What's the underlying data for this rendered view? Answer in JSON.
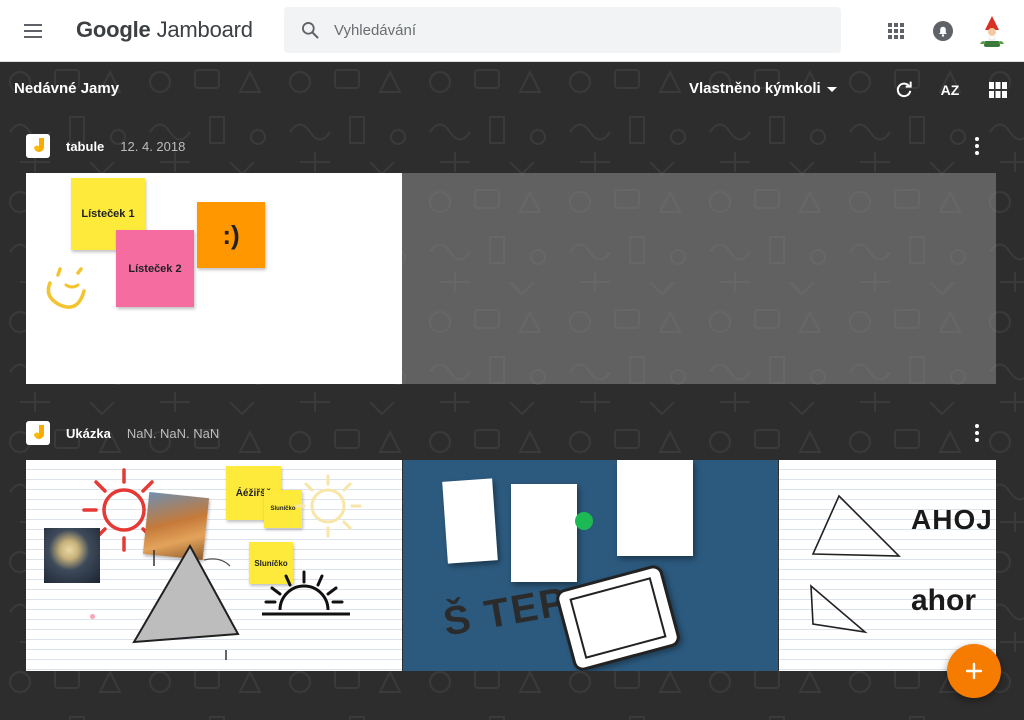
{
  "header": {
    "logo_google": "Google",
    "logo_product": "Jamboard",
    "search_placeholder": "Vyhledávání"
  },
  "toolbar": {
    "section_title": "Nedávné Jamy",
    "owner_filter": "Vlastněno kýmkoli",
    "sort_label": "AZ"
  },
  "jams": [
    {
      "name": "tabule",
      "date": "12. 4. 2018",
      "frames": [
        {
          "stickies": [
            "Lísteček 1",
            "Lísteček 2",
            ":)"
          ]
        }
      ]
    },
    {
      "name": "Ukázka",
      "date": "NaN. NaN. NaN",
      "frames": [
        {
          "stickies": [
            "Áéžiřšč",
            "Sluníčko",
            "Sluníčko"
          ]
        },
        {
          "text": "Š TEP"
        },
        {
          "texts": [
            "AHOJ",
            "ahor"
          ]
        }
      ]
    }
  ],
  "colors": {
    "accent": "#f57c00",
    "sticky_yellow": "#fdea3a",
    "sticky_pink": "#f56ca0",
    "sticky_orange": "#ff9800",
    "frame_blue": "#2c5a7e",
    "background": "#2d2d2d"
  },
  "icons": {
    "menu": "hamburger-icon",
    "search": "search-icon",
    "apps": "apps-grid-icon",
    "notifications": "bell-icon",
    "refresh": "refresh-icon",
    "sort": "sort-az-icon",
    "grid_view": "grid-view-icon",
    "more": "more-vert-icon",
    "add": "plus-icon"
  }
}
